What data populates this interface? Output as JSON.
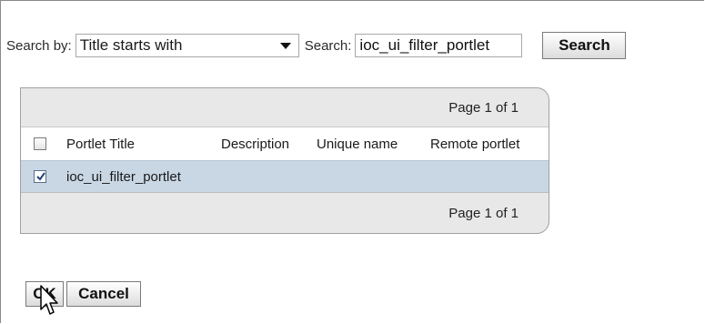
{
  "search": {
    "search_by_label": "Search by:",
    "search_by_value": "Title starts with",
    "search_label": "Search:",
    "search_value": "ioc_ui_filter_portlet",
    "search_button": "Search"
  },
  "table": {
    "pager_top": "Page 1 of 1",
    "pager_bottom": "Page 1 of 1",
    "columns": [
      "Portlet Title",
      "Description",
      "Unique name",
      "Remote portlet"
    ],
    "rows": [
      {
        "checked": true,
        "title": "ioc_ui_filter_portlet",
        "description": "",
        "unique_name": "",
        "remote_portlet": ""
      }
    ],
    "header_checked": false
  },
  "buttons": {
    "ok": "OK",
    "cancel": "Cancel"
  },
  "icons": {
    "cursor": "arrow-cursor-icon",
    "check": "checkmark-icon",
    "dropdown": "chevron-down-icon"
  }
}
